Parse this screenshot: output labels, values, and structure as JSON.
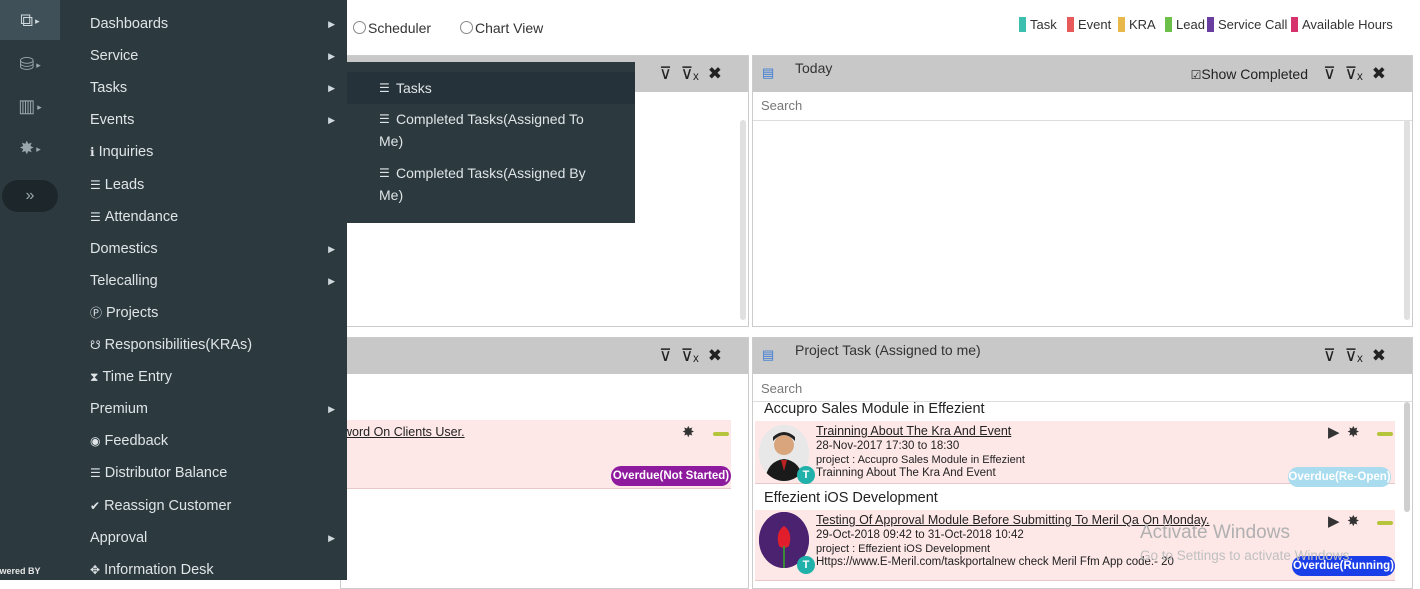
{
  "rail": {
    "powered_label": "owered BY",
    "items": [
      "layers-icon",
      "database-icon",
      "bar-chart-icon",
      "gear-icon",
      "double-chevron-right-icon"
    ]
  },
  "menu": {
    "items": [
      {
        "label": "Dashboards",
        "has_sub": true,
        "icon": ""
      },
      {
        "label": "Service",
        "has_sub": true,
        "icon": ""
      },
      {
        "label": "Tasks",
        "has_sub": true,
        "icon": ""
      },
      {
        "label": "Events",
        "has_sub": true,
        "icon": ""
      },
      {
        "label": "Inquiries",
        "has_sub": false,
        "icon": "ℹ"
      },
      {
        "label": "Leads",
        "has_sub": false,
        "icon": "☰"
      },
      {
        "label": "Attendance",
        "has_sub": false,
        "icon": "☰"
      },
      {
        "label": "Domestics",
        "has_sub": true,
        "icon": ""
      },
      {
        "label": "Telecalling",
        "has_sub": true,
        "icon": ""
      },
      {
        "label": "Projects",
        "has_sub": false,
        "icon": "Ⓟ"
      },
      {
        "label": "Responsibilities(KRAs)",
        "has_sub": false,
        "icon": "☋"
      },
      {
        "label": "Time Entry",
        "has_sub": false,
        "icon": "⧗"
      },
      {
        "label": "Premium",
        "has_sub": true,
        "icon": ""
      },
      {
        "label": "Feedback",
        "has_sub": false,
        "icon": "◉"
      },
      {
        "label": "Distributor Balance",
        "has_sub": false,
        "icon": "☰"
      },
      {
        "label": "Reassign Customer",
        "has_sub": false,
        "icon": "✔"
      },
      {
        "label": "Approval",
        "has_sub": true,
        "icon": ""
      },
      {
        "label": "Information Desk",
        "has_sub": false,
        "icon": "✥"
      }
    ]
  },
  "submenu": {
    "items": [
      {
        "line1": "Tasks",
        "line2": ""
      },
      {
        "line1": "Completed Tasks(Assigned To",
        "line2": "Me)"
      },
      {
        "line1": "Completed Tasks(Assigned By",
        "line2": "Me)"
      }
    ]
  },
  "topbar": {
    "radio_scheduler": "Scheduler",
    "radio_chart": "Chart View",
    "legend": [
      {
        "label": "Task",
        "color": "#3cbfae"
      },
      {
        "label": "Event",
        "color": "#e85a5a"
      },
      {
        "label": "KRA",
        "color": "#e8b84a"
      },
      {
        "label": "Lead",
        "color": "#6cc04a"
      },
      {
        "label": "Service Call",
        "color": "#6a3ea1"
      },
      {
        "label": "Available Hours",
        "color": "#d6336c"
      }
    ]
  },
  "panels": {
    "today": {
      "title": "Today",
      "show_completed": "Show Completed",
      "search_placeholder": "Search"
    },
    "project": {
      "title": "Project Task (Assigned to me)",
      "search_placeholder": "Search",
      "groups": [
        {
          "name": "Accupro Sales Module in Effezient",
          "task": {
            "title": "Trainning About The Kra And Event",
            "date": "28-Nov-2017 17:30 to 18:30",
            "project": "project : Accupro Sales Module in Effezient",
            "desc": "Trainning About The Kra And Event",
            "status": "Overdue(Re-Open)",
            "status_color": "#a9dcef",
            "avatar_badge": "T"
          }
        },
        {
          "name": "Effezient iOS Development",
          "task": {
            "title": "Testing Of Approval Module Before Submitting To Meril Qa On Monday.",
            "date": "29-Oct-2018 09:42 to 31-Oct-2018 10:42",
            "project": "project : Effezient iOS Development",
            "desc": "Https://www.E-Meril.com/taskportalnew check Meril Ffm App code:- 20",
            "status": "Overdue(Running)",
            "status_color": "#1a3ee8",
            "avatar_badge": "T"
          }
        }
      ]
    },
    "left_bottom": {
      "task_title": "word On Clients User.",
      "status": "Overdue(Not Started)",
      "status_color": "#8e1a9e"
    }
  },
  "watermark": {
    "line1": "Activate Windows",
    "line2": "Go to Settings to activate Windows."
  }
}
